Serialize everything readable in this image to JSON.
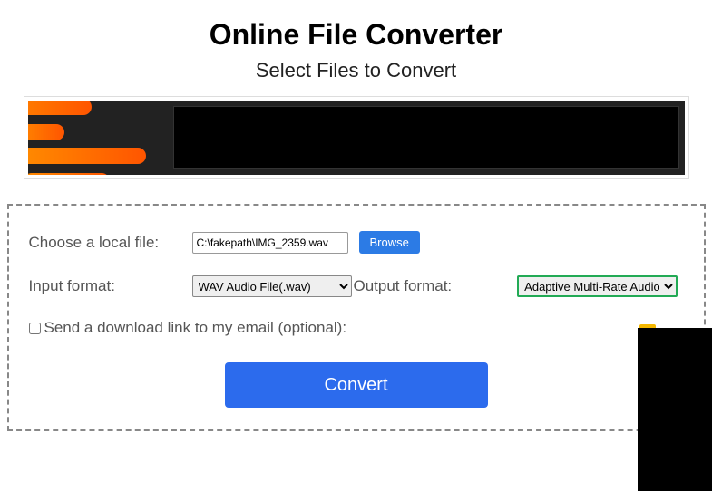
{
  "header": {
    "title": "Online File Converter",
    "subtitle": "Select Files to Convert"
  },
  "form": {
    "choose_file_label": "Choose a local file:",
    "file_value": "C:\\fakepath\\IMG_2359.wav",
    "browse_label": "Browse",
    "input_format_label": "Input format:",
    "input_format_value": "WAV Audio File(.wav)",
    "output_format_label": "Output format:",
    "output_format_value": "Adaptive Multi-Rate Audio F",
    "email_label": "Send a download link to my email (optional):",
    "convert_label": "Convert"
  }
}
